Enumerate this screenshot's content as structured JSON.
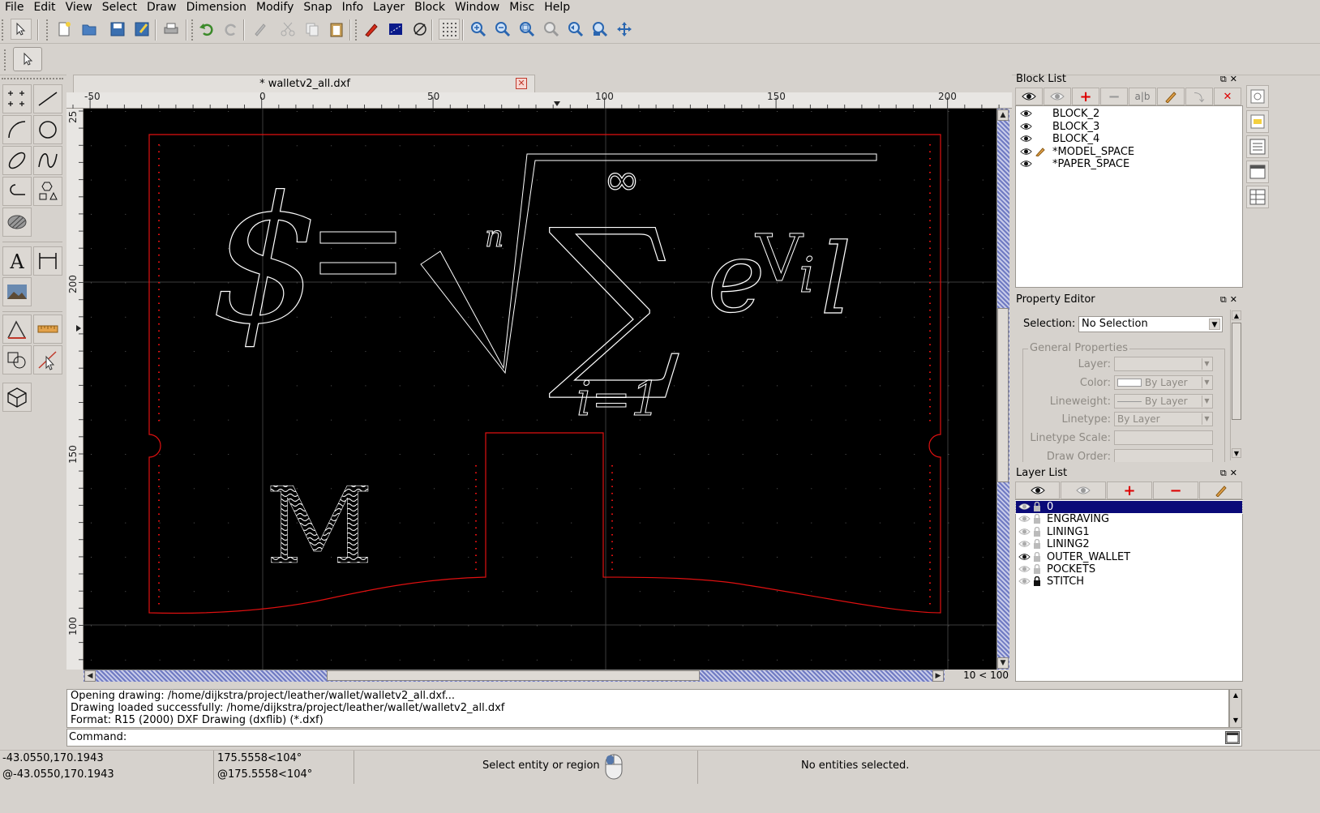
{
  "menu": [
    "File",
    "Edit",
    "View",
    "Select",
    "Draw",
    "Dimension",
    "Modify",
    "Snap",
    "Info",
    "Layer",
    "Block",
    "Window",
    "Misc",
    "Help"
  ],
  "document": {
    "tab_title": "* walletv2_all.dxf",
    "close_glyph": "✕"
  },
  "rulers": {
    "top": [
      "-50",
      "0",
      "50",
      "100",
      "150",
      "200"
    ],
    "left": [
      "25",
      "200",
      "150",
      "100"
    ]
  },
  "drawing_text": {
    "dollar": "$",
    "equals": "=",
    "root_index": "n",
    "sigma": "∑",
    "infinity": "∞",
    "lower_limit": "i=1",
    "e": "e",
    "exponent_v": "V",
    "exponent_i": "i",
    "l": "l",
    "monogram": "M"
  },
  "grid_info": "10 < 100",
  "block_list": {
    "title": "Block List",
    "items": [
      {
        "name": "BLOCK_2",
        "editing": false
      },
      {
        "name": "BLOCK_3",
        "editing": false
      },
      {
        "name": "BLOCK_4",
        "editing": false
      },
      {
        "name": "*MODEL_SPACE",
        "editing": true
      },
      {
        "name": "*PAPER_SPACE",
        "editing": false
      }
    ]
  },
  "property_editor": {
    "title": "Property Editor",
    "selection_label": "Selection:",
    "selection_value": "No Selection",
    "group_title": "General Properties",
    "rows": [
      {
        "label": "Layer:",
        "value": ""
      },
      {
        "label": "Color:",
        "value": "By Layer"
      },
      {
        "label": "Lineweight:",
        "value": "By Layer"
      },
      {
        "label": "Linetype:",
        "value": "By Layer"
      },
      {
        "label": "Linetype Scale:",
        "value": ""
      },
      {
        "label": "Draw Order:",
        "value": ""
      }
    ]
  },
  "layer_list": {
    "title": "Layer List",
    "items": [
      {
        "name": "0",
        "visible": false,
        "locked": false,
        "selected": true
      },
      {
        "name": "ENGRAVING",
        "visible": false,
        "locked": false,
        "selected": false
      },
      {
        "name": "LINING1",
        "visible": false,
        "locked": false,
        "selected": false
      },
      {
        "name": "LINING2",
        "visible": false,
        "locked": false,
        "selected": false
      },
      {
        "name": "OUTER_WALLET",
        "visible": true,
        "locked": false,
        "selected": false
      },
      {
        "name": "POCKETS",
        "visible": false,
        "locked": false,
        "selected": false
      },
      {
        "name": "STITCH",
        "visible": false,
        "locked": true,
        "selected": false
      }
    ]
  },
  "command_history": [
    "Opening drawing: /home/dijkstra/project/leather/wallet/walletv2_all.dxf...",
    "Drawing loaded successfully: /home/dijkstra/project/leather/wallet/walletv2_all.dxf",
    "Format: R15 (2000) DXF Drawing (dxflib) (*.dxf)"
  ],
  "command_prompt": "Command:",
  "status": {
    "abs_coord": "-43.0550,170.1943",
    "rel_coord": "@-43.0550,170.1943",
    "polar_coord": "175.5558<104°",
    "rel_polar_coord": "@175.5558<104°",
    "hint": "Select entity or region",
    "selection": "No entities selected."
  },
  "colors": {
    "canvas_bg": "#000000",
    "outline_red": "#e01010",
    "engraving_white": "#ffffff",
    "selection_blue": "#0a0a78"
  }
}
